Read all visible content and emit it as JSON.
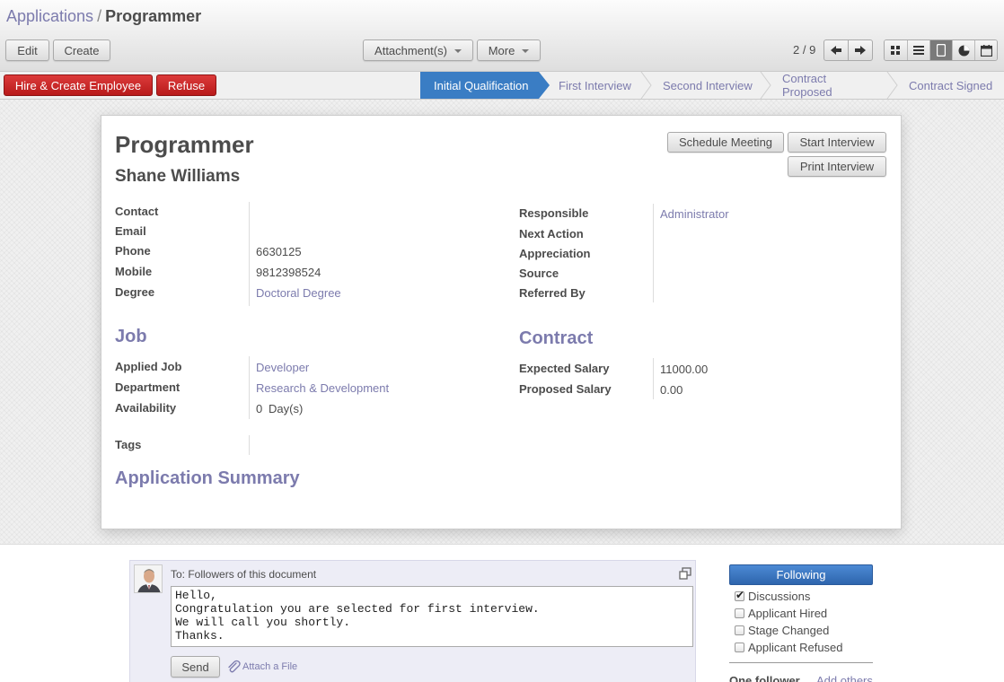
{
  "breadcrumb": {
    "parent": "Applications",
    "separator": "/",
    "current": "Programmer"
  },
  "toolbar": {
    "edit": "Edit",
    "create": "Create",
    "attachments": "Attachment(s)",
    "more": "More",
    "pager": "2 / 9",
    "views": [
      "kanban-view-icon",
      "list-view-icon",
      "form-view-icon",
      "graph-view-icon",
      "calendar-view-icon"
    ]
  },
  "statusbar": {
    "hire_button": "Hire & Create Employee",
    "refuse_button": "Refuse",
    "stages": [
      "Initial Qualification",
      "First Interview",
      "Second Interview",
      "Contract Proposed",
      "Contract Signed"
    ],
    "active_stage": "Initial Qualification"
  },
  "form": {
    "title": "Programmer",
    "applicant": "Shane Williams",
    "buttons": {
      "schedule": "Schedule Meeting",
      "start": "Start Interview",
      "print": "Print Interview"
    },
    "left": {
      "contact_label": "Contact",
      "contact": "",
      "email_label": "Email",
      "email": "",
      "phone_label": "Phone",
      "phone": "6630125",
      "mobile_label": "Mobile",
      "mobile": "9812398524",
      "degree_label": "Degree",
      "degree": "Doctoral Degree"
    },
    "right": {
      "responsible_label": "Responsible",
      "responsible": "Administrator",
      "next_action_label": "Next Action",
      "appreciation_label": "Appreciation",
      "source_label": "Source",
      "referred_label": "Referred By"
    },
    "job": {
      "heading": "Job",
      "applied_job_label": "Applied Job",
      "applied_job": "Developer",
      "department_label": "Department",
      "department": "Research & Development",
      "availability_label": "Availability",
      "availability_value": "0",
      "availability_unit": "Day(s)"
    },
    "contract": {
      "heading": "Contract",
      "expected_label": "Expected Salary",
      "expected": "11000.00",
      "proposed_label": "Proposed Salary",
      "proposed": "0.00"
    },
    "tags_label": "Tags",
    "summary_heading": "Application Summary"
  },
  "chatter": {
    "to": "To: Followers of this document",
    "message": "Hello,\nCongratulation you are selected for first interview.\nWe will call you shortly.\nThanks.",
    "send": "Send",
    "attach": "Attach a File",
    "following": "Following",
    "subtypes": [
      {
        "label": "Discussions",
        "checked": true
      },
      {
        "label": "Applicant Hired",
        "checked": false
      },
      {
        "label": "Stage Changed",
        "checked": false
      },
      {
        "label": "Applicant Refused",
        "checked": false
      }
    ],
    "follower_count": "One follower",
    "add_others": "Add others"
  },
  "colors": {
    "link": "#7c7bad",
    "stage_active": "#3a7dc4",
    "danger": "#c22424",
    "following": "#3b74c0"
  }
}
